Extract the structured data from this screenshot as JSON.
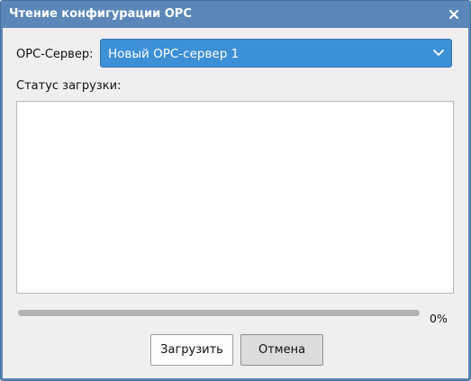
{
  "window": {
    "title": "Чтение конфигурации OPC"
  },
  "form": {
    "server_label": "OPC-Сервер:",
    "server_selected": "Новый OPC-сервер 1",
    "status_label": "Статус загрузки:",
    "status_text": ""
  },
  "progress": {
    "value_percent": 0,
    "text": "0%"
  },
  "buttons": {
    "load_label": "Загрузить",
    "cancel_label": "Отмена"
  },
  "colors": {
    "titlebar": "#5b87b8",
    "accent": "#3d8fd6",
    "dialog_bg": "#efefef"
  },
  "icons": {
    "close": "close-icon",
    "dropdown": "chevron-down-icon"
  }
}
